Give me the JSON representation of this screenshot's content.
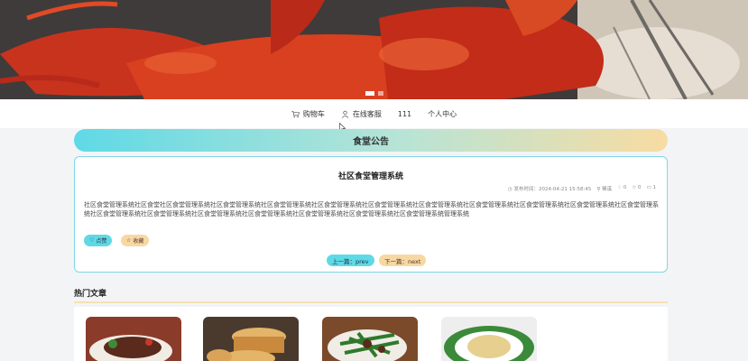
{
  "nav": {
    "cart_label": "购物车",
    "service_label": "在线客服",
    "user_label": "111",
    "center_label": "个人中心"
  },
  "notice": {
    "title": "食堂公告"
  },
  "article": {
    "title": "社区食堂管理系统",
    "meta": {
      "publish_time": "发布时间：2024-04-21 15:58:45",
      "author": "稀溪",
      "likes": "0",
      "favorites": "0",
      "views": "1"
    },
    "body": "社区食堂管理系统社区食堂社区食堂管理系统社区食堂管理系统社区食堂管理系统社区食堂管理系统社区食堂管理系统社区食堂管理系统社区食堂管理系统社区食堂管理系统社区食堂管理系统社区食堂管理系统社区食堂管理系统社区食堂管理系统社区食堂管理系统社区食堂管理系统社区食堂管理系统社区食堂管理系统社区食堂管理系统管理系统",
    "like_label": "点赞",
    "favorite_label": "收藏",
    "prev_label": "上一篇：prev",
    "next_label": "下一篇：next"
  },
  "hot": {
    "title": "热门文章"
  },
  "colors": {
    "accent_cyan": "#5fd9e6",
    "accent_peach": "#f8d8a2"
  }
}
